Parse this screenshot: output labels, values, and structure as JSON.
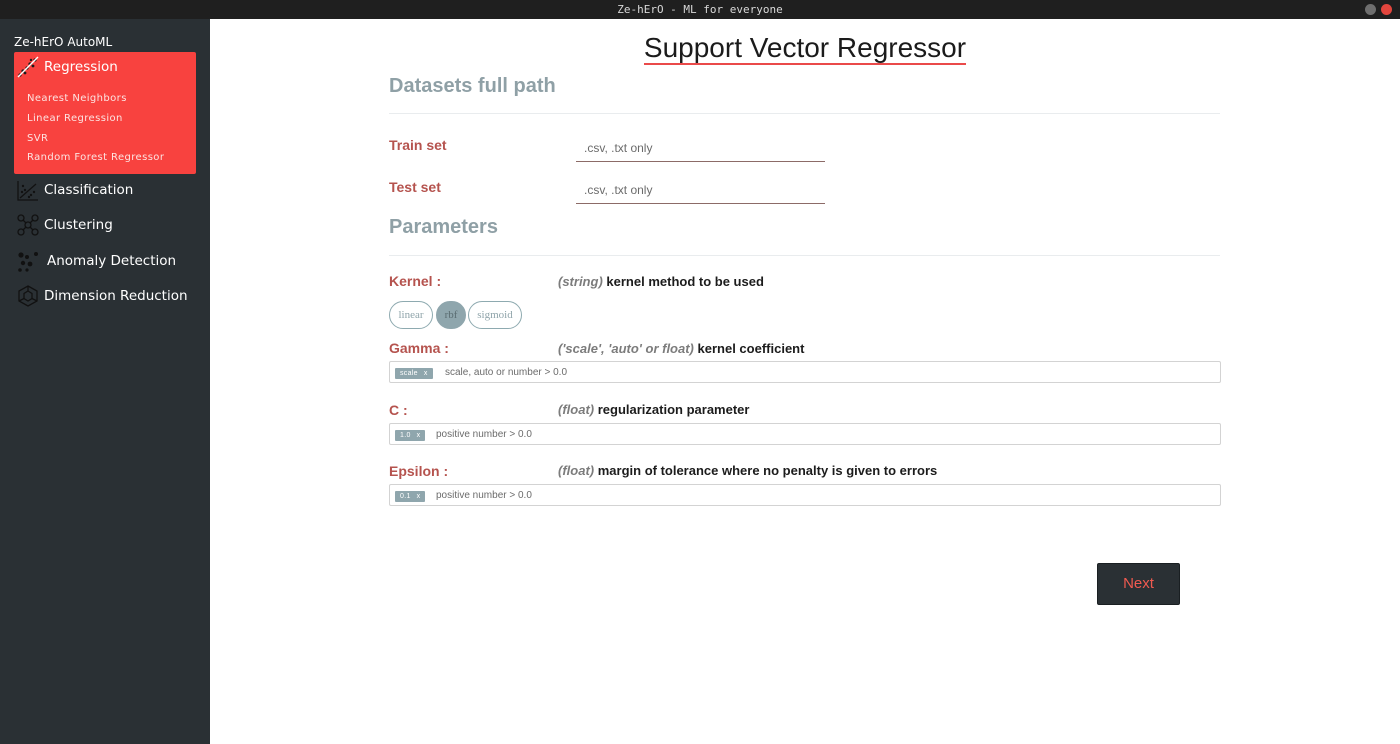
{
  "window": {
    "title": "Ze-hErO - ML for everyone"
  },
  "sidebar": {
    "app_name": "Ze-hErO AutoML",
    "items": [
      {
        "label": "Regression",
        "icon": "regression-icon",
        "active": true
      },
      {
        "label": "Classification",
        "icon": "classification-icon"
      },
      {
        "label": "Clustering",
        "icon": "clustering-icon"
      },
      {
        "label": "Anomaly Detection",
        "icon": "anomaly-icon"
      },
      {
        "label": "Dimension Reduction",
        "icon": "dimension-reduction-icon"
      }
    ],
    "regression_subitems": [
      "Nearest Neighbors",
      "Linear Regression",
      "SVR",
      "Random Forest Regressor"
    ]
  },
  "main": {
    "title": "Support Vector Regressor",
    "datasets_heading": "Datasets full path",
    "train_label": "Train set",
    "train_placeholder": ".csv, .txt only",
    "test_label": "Test set",
    "test_placeholder": ".csv, .txt only",
    "parameters_heading": "Parameters",
    "kernel": {
      "label": "Kernel :",
      "type": "(string)",
      "desc": "kernel method to be used",
      "options": [
        "linear",
        "rbf",
        "sigmoid"
      ],
      "selected": "rbf"
    },
    "gamma": {
      "label": "Gamma :",
      "type": "('scale', 'auto' or float)",
      "desc": "kernel coefficient",
      "tag": "scale",
      "placeholder": "scale, auto or number > 0.0"
    },
    "c": {
      "label": "C :",
      "type": "(float)",
      "desc": "regularization parameter",
      "tag": "1.0",
      "placeholder": "positive number > 0.0"
    },
    "epsilon": {
      "label": "Epsilon :",
      "type": "(float)",
      "desc": "margin of tolerance where no penalty is given to errors",
      "tag": "0.1",
      "placeholder": "positive number > 0.0"
    },
    "tag_remove": "x",
    "next_label": "Next"
  },
  "colors": {
    "sidebar_bg": "#2a3034",
    "active_nav": "#f8423f",
    "label_red": "#b5534e",
    "accent_grey": "#8fa6ad",
    "next_text": "#f05a50"
  }
}
